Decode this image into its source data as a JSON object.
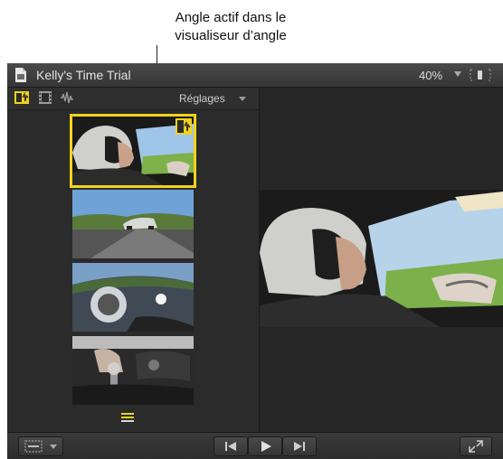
{
  "callout": {
    "line1": "Angle actif dans le",
    "line2": "visualiseur d’angle"
  },
  "window": {
    "title": "Kelly's Time Trial",
    "zoom_level": "40%",
    "accent_color": "#f2d21b"
  },
  "angle_panel": {
    "toolbar": {
      "icons": [
        "video-audio-angle-icon",
        "video-only-icon",
        "audio-only-icon"
      ],
      "settings_label": "Réglages"
    },
    "thumbnails": [
      {
        "name": "driver-helmet-angle",
        "active": true
      },
      {
        "name": "car-on-track-angle",
        "active": false
      },
      {
        "name": "fisheye-cockpit-angle",
        "active": false
      },
      {
        "name": "gear-shifter-angle",
        "active": false
      }
    ]
  },
  "controls": {
    "icons": [
      "view-options-icon",
      "previous-icon",
      "play-icon",
      "next-icon",
      "fullscreen-icon"
    ]
  }
}
